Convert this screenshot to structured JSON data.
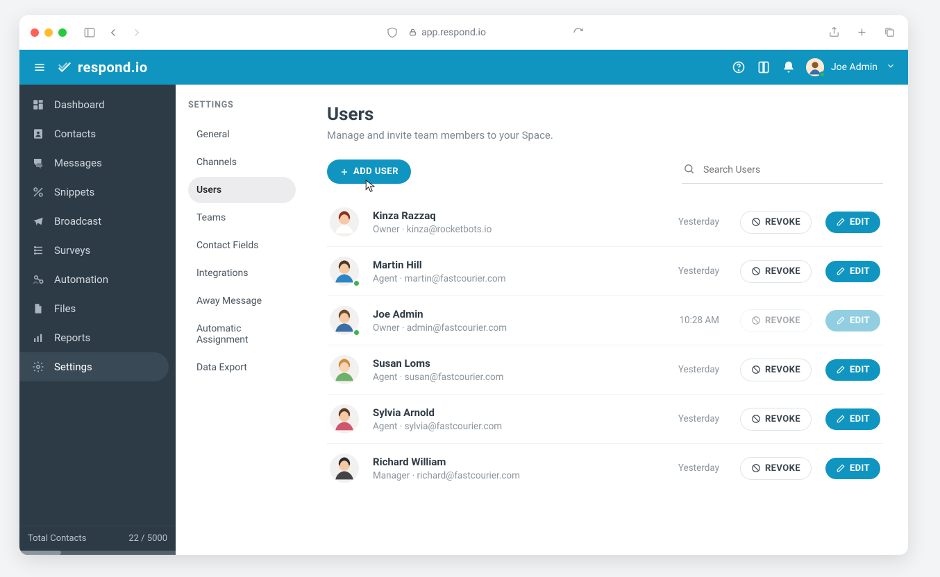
{
  "browser": {
    "url": "app.respond.io"
  },
  "brand": "respond.io",
  "top_user": "Joe Admin",
  "sidebar": {
    "items": [
      {
        "label": "Dashboard"
      },
      {
        "label": "Contacts"
      },
      {
        "label": "Messages"
      },
      {
        "label": "Snippets"
      },
      {
        "label": "Broadcast"
      },
      {
        "label": "Surveys"
      },
      {
        "label": "Automation"
      },
      {
        "label": "Files"
      },
      {
        "label": "Reports"
      },
      {
        "label": "Settings"
      }
    ],
    "footer_label": "Total Contacts",
    "footer_count": "22 / 5000"
  },
  "settings": {
    "heading": "SETTINGS",
    "items": [
      {
        "label": "General"
      },
      {
        "label": "Channels"
      },
      {
        "label": "Users"
      },
      {
        "label": "Teams"
      },
      {
        "label": "Contact Fields"
      },
      {
        "label": "Integrations"
      },
      {
        "label": "Away Message"
      },
      {
        "label": "Automatic Assignment"
      },
      {
        "label": "Data Export"
      }
    ]
  },
  "panel": {
    "title": "Users",
    "subtitle": "Manage and invite team members to your Space.",
    "add_user_label": "ADD USER",
    "search_placeholder": "Search Users",
    "revoke_label": "REVOKE",
    "edit_label": "EDIT"
  },
  "users": [
    {
      "name": "Kinza Razzaq",
      "role": "Owner",
      "email": "kinza@rocketbots.io",
      "time": "Yesterday",
      "self": false,
      "online": false
    },
    {
      "name": "Martin Hill",
      "role": "Agent",
      "email": "martin@fastcourier.com",
      "time": "Yesterday",
      "self": false,
      "online": true
    },
    {
      "name": "Joe Admin",
      "role": "Owner",
      "email": "admin@fastcourier.com",
      "time": "10:28 AM",
      "self": true,
      "online": true
    },
    {
      "name": "Susan Loms",
      "role": "Agent",
      "email": "susan@fastcourier.com",
      "time": "Yesterday",
      "self": false,
      "online": false
    },
    {
      "name": "Sylvia Arnold",
      "role": "Agent",
      "email": "sylvia@fastcourier.com",
      "time": "Yesterday",
      "self": false,
      "online": false
    },
    {
      "name": "Richard William",
      "role": "Manager",
      "email": "richard@fastcourier.com",
      "time": "Yesterday",
      "self": false,
      "online": false
    }
  ]
}
